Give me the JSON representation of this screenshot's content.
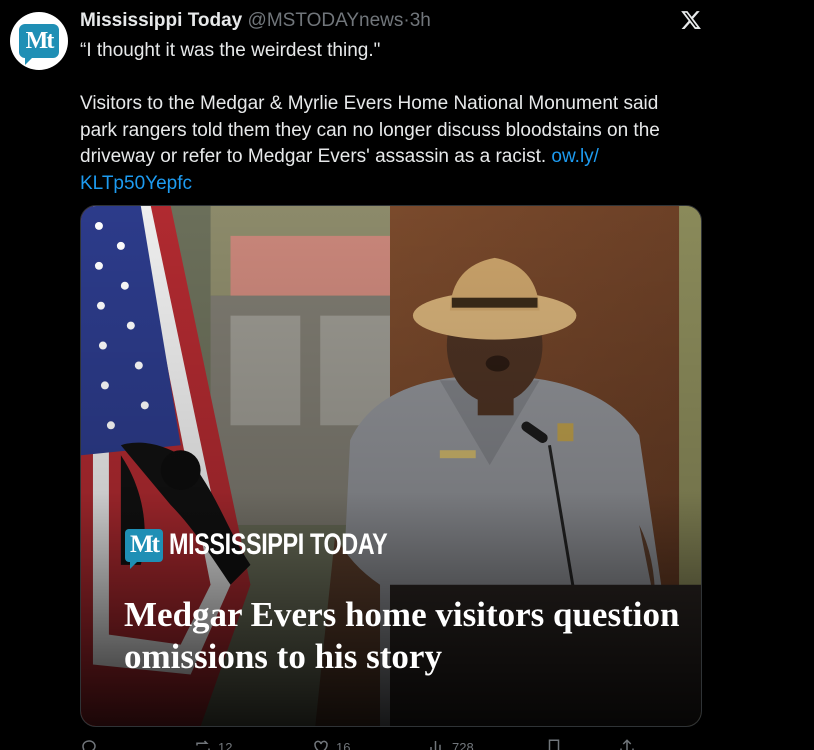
{
  "tweet": {
    "author_name": "Mississippi Today",
    "handle": "@MSTODAYnews",
    "separator": "·",
    "time": "3h",
    "avatar_text": "Mt",
    "quote_line": "“I thought it was the weirdest thing.\"",
    "body_before_link": "Visitors to the Medgar & Myrlie Evers Home National Monument said park rangers told them they can no longer discuss bloodstains on the driveway or refer to Medgar Evers' assassin as a racist. ",
    "link_text": "ow.ly/ KLTp50Yepfc"
  },
  "card": {
    "brand_mark": "Mt",
    "brand_name": "MISSISSIPPI TODAY",
    "headline": "Medgar Evers home visitors question omissions to his story"
  },
  "actions": {
    "reply_count": "",
    "repost_count": "12",
    "like_count": "16",
    "views_count": "728"
  },
  "colors": {
    "background": "#000000",
    "text": "#e7e9ea",
    "muted": "#71767b",
    "link": "#1d9bf0",
    "brand": "#1f8fb5"
  }
}
